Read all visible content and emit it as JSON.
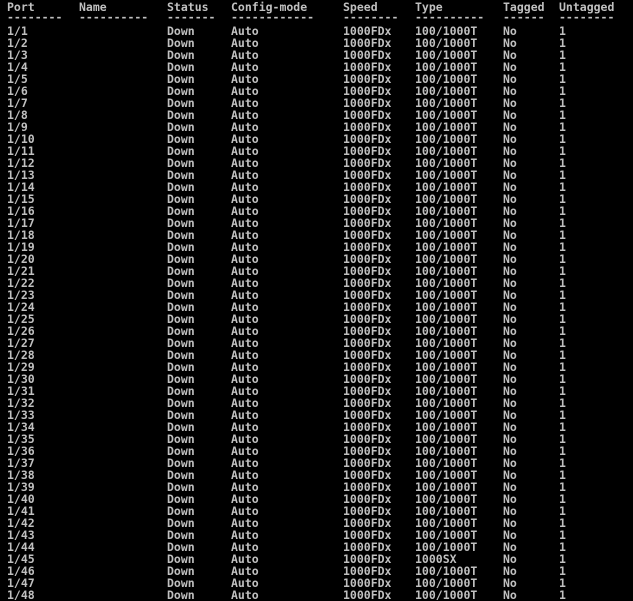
{
  "header": {
    "port": "Port",
    "name": "Name",
    "status": "Status",
    "config_mode": "Config-mode",
    "speed": "Speed",
    "type": "Type",
    "tagged": "Tagged",
    "untagged": "Untagged"
  },
  "separators": {
    "port": "--------",
    "name": "----------",
    "status": "-------",
    "config_mode": "------------",
    "speed": "--------",
    "type": "----------",
    "tagged": "------",
    "untagged": "--------"
  },
  "rows": [
    {
      "port": "1/1",
      "name": "",
      "status": "Down",
      "config_mode": "Auto",
      "speed": "1000FDx",
      "type": "100/1000T",
      "tagged": "No",
      "untagged": "1"
    },
    {
      "port": "1/2",
      "name": "",
      "status": "Down",
      "config_mode": "Auto",
      "speed": "1000FDx",
      "type": "100/1000T",
      "tagged": "No",
      "untagged": "1"
    },
    {
      "port": "1/3",
      "name": "",
      "status": "Down",
      "config_mode": "Auto",
      "speed": "1000FDx",
      "type": "100/1000T",
      "tagged": "No",
      "untagged": "1"
    },
    {
      "port": "1/4",
      "name": "",
      "status": "Down",
      "config_mode": "Auto",
      "speed": "1000FDx",
      "type": "100/1000T",
      "tagged": "No",
      "untagged": "1"
    },
    {
      "port": "1/5",
      "name": "",
      "status": "Down",
      "config_mode": "Auto",
      "speed": "1000FDx",
      "type": "100/1000T",
      "tagged": "No",
      "untagged": "1"
    },
    {
      "port": "1/6",
      "name": "",
      "status": "Down",
      "config_mode": "Auto",
      "speed": "1000FDx",
      "type": "100/1000T",
      "tagged": "No",
      "untagged": "1"
    },
    {
      "port": "1/7",
      "name": "",
      "status": "Down",
      "config_mode": "Auto",
      "speed": "1000FDx",
      "type": "100/1000T",
      "tagged": "No",
      "untagged": "1"
    },
    {
      "port": "1/8",
      "name": "",
      "status": "Down",
      "config_mode": "Auto",
      "speed": "1000FDx",
      "type": "100/1000T",
      "tagged": "No",
      "untagged": "1"
    },
    {
      "port": "1/9",
      "name": "",
      "status": "Down",
      "config_mode": "Auto",
      "speed": "1000FDx",
      "type": "100/1000T",
      "tagged": "No",
      "untagged": "1"
    },
    {
      "port": "1/10",
      "name": "",
      "status": "Down",
      "config_mode": "Auto",
      "speed": "1000FDx",
      "type": "100/1000T",
      "tagged": "No",
      "untagged": "1"
    },
    {
      "port": "1/11",
      "name": "",
      "status": "Down",
      "config_mode": "Auto",
      "speed": "1000FDx",
      "type": "100/1000T",
      "tagged": "No",
      "untagged": "1"
    },
    {
      "port": "1/12",
      "name": "",
      "status": "Down",
      "config_mode": "Auto",
      "speed": "1000FDx",
      "type": "100/1000T",
      "tagged": "No",
      "untagged": "1"
    },
    {
      "port": "1/13",
      "name": "",
      "status": "Down",
      "config_mode": "Auto",
      "speed": "1000FDx",
      "type": "100/1000T",
      "tagged": "No",
      "untagged": "1"
    },
    {
      "port": "1/14",
      "name": "",
      "status": "Down",
      "config_mode": "Auto",
      "speed": "1000FDx",
      "type": "100/1000T",
      "tagged": "No",
      "untagged": "1"
    },
    {
      "port": "1/15",
      "name": "",
      "status": "Down",
      "config_mode": "Auto",
      "speed": "1000FDx",
      "type": "100/1000T",
      "tagged": "No",
      "untagged": "1"
    },
    {
      "port": "1/16",
      "name": "",
      "status": "Down",
      "config_mode": "Auto",
      "speed": "1000FDx",
      "type": "100/1000T",
      "tagged": "No",
      "untagged": "1"
    },
    {
      "port": "1/17",
      "name": "",
      "status": "Down",
      "config_mode": "Auto",
      "speed": "1000FDx",
      "type": "100/1000T",
      "tagged": "No",
      "untagged": "1"
    },
    {
      "port": "1/18",
      "name": "",
      "status": "Down",
      "config_mode": "Auto",
      "speed": "1000FDx",
      "type": "100/1000T",
      "tagged": "No",
      "untagged": "1"
    },
    {
      "port": "1/19",
      "name": "",
      "status": "Down",
      "config_mode": "Auto",
      "speed": "1000FDx",
      "type": "100/1000T",
      "tagged": "No",
      "untagged": "1"
    },
    {
      "port": "1/20",
      "name": "",
      "status": "Down",
      "config_mode": "Auto",
      "speed": "1000FDx",
      "type": "100/1000T",
      "tagged": "No",
      "untagged": "1"
    },
    {
      "port": "1/21",
      "name": "",
      "status": "Down",
      "config_mode": "Auto",
      "speed": "1000FDx",
      "type": "100/1000T",
      "tagged": "No",
      "untagged": "1"
    },
    {
      "port": "1/22",
      "name": "",
      "status": "Down",
      "config_mode": "Auto",
      "speed": "1000FDx",
      "type": "100/1000T",
      "tagged": "No",
      "untagged": "1"
    },
    {
      "port": "1/23",
      "name": "",
      "status": "Down",
      "config_mode": "Auto",
      "speed": "1000FDx",
      "type": "100/1000T",
      "tagged": "No",
      "untagged": "1"
    },
    {
      "port": "1/24",
      "name": "",
      "status": "Down",
      "config_mode": "Auto",
      "speed": "1000FDx",
      "type": "100/1000T",
      "tagged": "No",
      "untagged": "1"
    },
    {
      "port": "1/25",
      "name": "",
      "status": "Down",
      "config_mode": "Auto",
      "speed": "1000FDx",
      "type": "100/1000T",
      "tagged": "No",
      "untagged": "1"
    },
    {
      "port": "1/26",
      "name": "",
      "status": "Down",
      "config_mode": "Auto",
      "speed": "1000FDx",
      "type": "100/1000T",
      "tagged": "No",
      "untagged": "1"
    },
    {
      "port": "1/27",
      "name": "",
      "status": "Down",
      "config_mode": "Auto",
      "speed": "1000FDx",
      "type": "100/1000T",
      "tagged": "No",
      "untagged": "1"
    },
    {
      "port": "1/28",
      "name": "",
      "status": "Down",
      "config_mode": "Auto",
      "speed": "1000FDx",
      "type": "100/1000T",
      "tagged": "No",
      "untagged": "1"
    },
    {
      "port": "1/29",
      "name": "",
      "status": "Down",
      "config_mode": "Auto",
      "speed": "1000FDx",
      "type": "100/1000T",
      "tagged": "No",
      "untagged": "1"
    },
    {
      "port": "1/30",
      "name": "",
      "status": "Down",
      "config_mode": "Auto",
      "speed": "1000FDx",
      "type": "100/1000T",
      "tagged": "No",
      "untagged": "1"
    },
    {
      "port": "1/31",
      "name": "",
      "status": "Down",
      "config_mode": "Auto",
      "speed": "1000FDx",
      "type": "100/1000T",
      "tagged": "No",
      "untagged": "1"
    },
    {
      "port": "1/32",
      "name": "",
      "status": "Down",
      "config_mode": "Auto",
      "speed": "1000FDx",
      "type": "100/1000T",
      "tagged": "No",
      "untagged": "1"
    },
    {
      "port": "1/33",
      "name": "",
      "status": "Down",
      "config_mode": "Auto",
      "speed": "1000FDx",
      "type": "100/1000T",
      "tagged": "No",
      "untagged": "1"
    },
    {
      "port": "1/34",
      "name": "",
      "status": "Down",
      "config_mode": "Auto",
      "speed": "1000FDx",
      "type": "100/1000T",
      "tagged": "No",
      "untagged": "1"
    },
    {
      "port": "1/35",
      "name": "",
      "status": "Down",
      "config_mode": "Auto",
      "speed": "1000FDx",
      "type": "100/1000T",
      "tagged": "No",
      "untagged": "1"
    },
    {
      "port": "1/36",
      "name": "",
      "status": "Down",
      "config_mode": "Auto",
      "speed": "1000FDx",
      "type": "100/1000T",
      "tagged": "No",
      "untagged": "1"
    },
    {
      "port": "1/37",
      "name": "",
      "status": "Down",
      "config_mode": "Auto",
      "speed": "1000FDx",
      "type": "100/1000T",
      "tagged": "No",
      "untagged": "1"
    },
    {
      "port": "1/38",
      "name": "",
      "status": "Down",
      "config_mode": "Auto",
      "speed": "1000FDx",
      "type": "100/1000T",
      "tagged": "No",
      "untagged": "1"
    },
    {
      "port": "1/39",
      "name": "",
      "status": "Down",
      "config_mode": "Auto",
      "speed": "1000FDx",
      "type": "100/1000T",
      "tagged": "No",
      "untagged": "1"
    },
    {
      "port": "1/40",
      "name": "",
      "status": "Down",
      "config_mode": "Auto",
      "speed": "1000FDx",
      "type": "100/1000T",
      "tagged": "No",
      "untagged": "1"
    },
    {
      "port": "1/41",
      "name": "",
      "status": "Down",
      "config_mode": "Auto",
      "speed": "1000FDx",
      "type": "100/1000T",
      "tagged": "No",
      "untagged": "1"
    },
    {
      "port": "1/42",
      "name": "",
      "status": "Down",
      "config_mode": "Auto",
      "speed": "1000FDx",
      "type": "100/1000T",
      "tagged": "No",
      "untagged": "1"
    },
    {
      "port": "1/43",
      "name": "",
      "status": "Down",
      "config_mode": "Auto",
      "speed": "1000FDx",
      "type": "100/1000T",
      "tagged": "No",
      "untagged": "1"
    },
    {
      "port": "1/44",
      "name": "",
      "status": "Down",
      "config_mode": "Auto",
      "speed": "1000FDx",
      "type": "100/1000T",
      "tagged": "No",
      "untagged": "1"
    },
    {
      "port": "1/45",
      "name": "",
      "status": "Down",
      "config_mode": "Auto",
      "speed": "1000FDx",
      "type": "1000SX",
      "tagged": "No",
      "untagged": "1"
    },
    {
      "port": "1/46",
      "name": "",
      "status": "Down",
      "config_mode": "Auto",
      "speed": "1000FDx",
      "type": "100/1000T",
      "tagged": "No",
      "untagged": "1"
    },
    {
      "port": "1/47",
      "name": "",
      "status": "Down",
      "config_mode": "Auto",
      "speed": "1000FDx",
      "type": "100/1000T",
      "tagged": "No",
      "untagged": "1"
    },
    {
      "port": "1/48",
      "name": "",
      "status": "Down",
      "config_mode": "Auto",
      "speed": "1000FDx",
      "type": "100/1000T",
      "tagged": "No",
      "untagged": "1"
    }
  ]
}
